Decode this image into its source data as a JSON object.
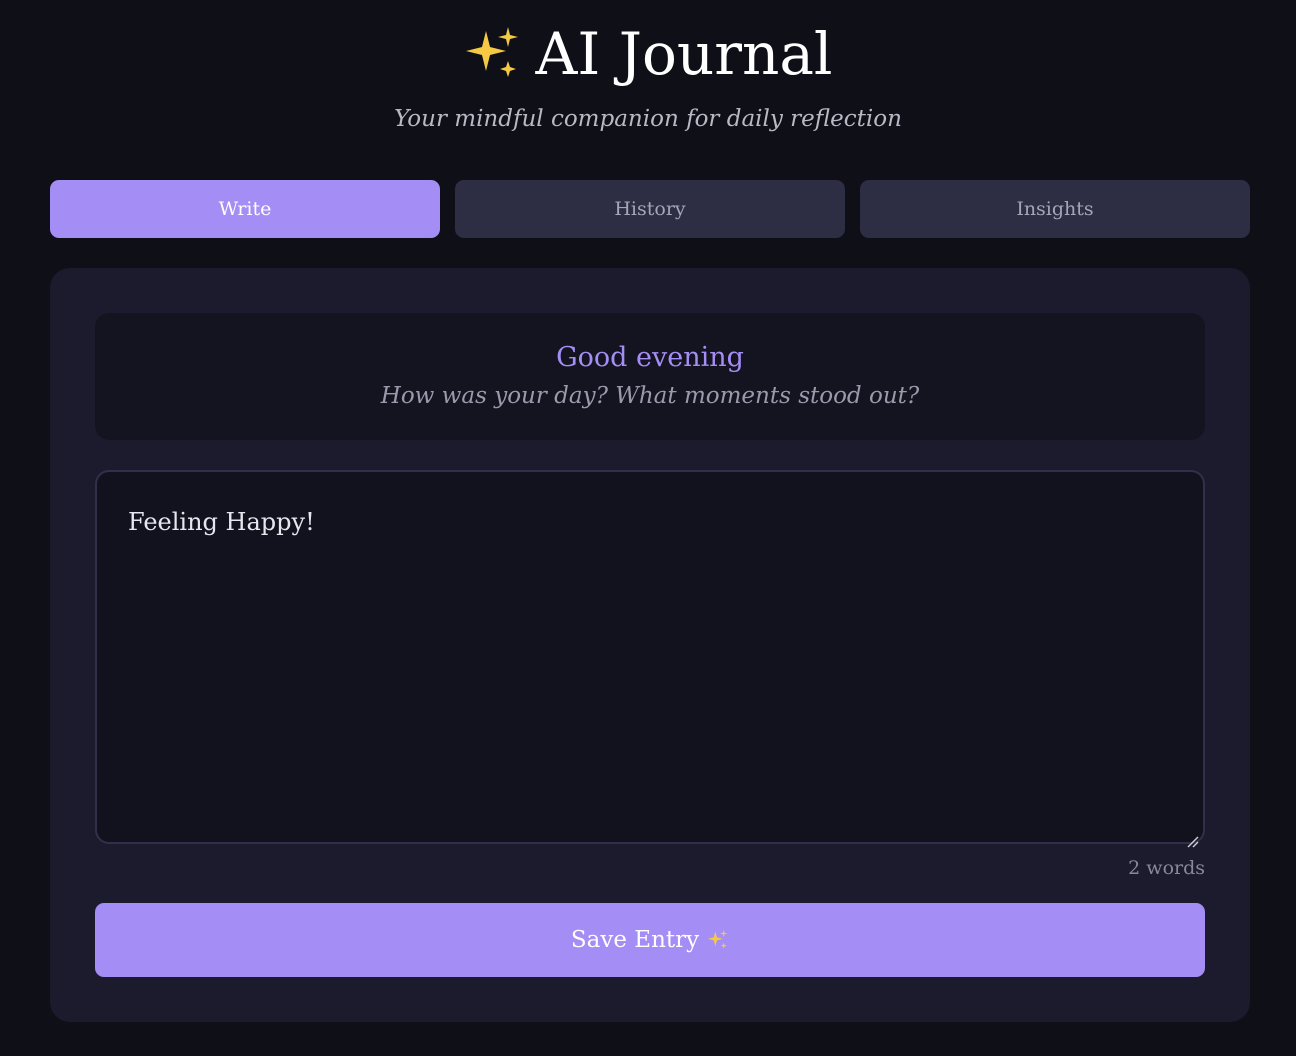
{
  "header": {
    "title": "AI Journal",
    "subtitle": "Your mindful companion for daily reflection",
    "title_icon": "sparkles-icon"
  },
  "tabs": [
    {
      "label": "Write",
      "active": true
    },
    {
      "label": "History",
      "active": false
    },
    {
      "label": "Insights",
      "active": false
    }
  ],
  "greeting": {
    "title": "Good evening",
    "prompt": "How was your day? What moments stood out?"
  },
  "editor": {
    "value": "Feeling Happy!"
  },
  "word_count": "2 words",
  "save_button": {
    "label": "Save Entry",
    "icon": "sparkles-icon"
  },
  "colors": {
    "background": "#0f0f18",
    "card": "#1b1b2d",
    "accent": "#a48df4",
    "tab_inactive": "#2d2d44",
    "sparkle": "#f6c945"
  }
}
